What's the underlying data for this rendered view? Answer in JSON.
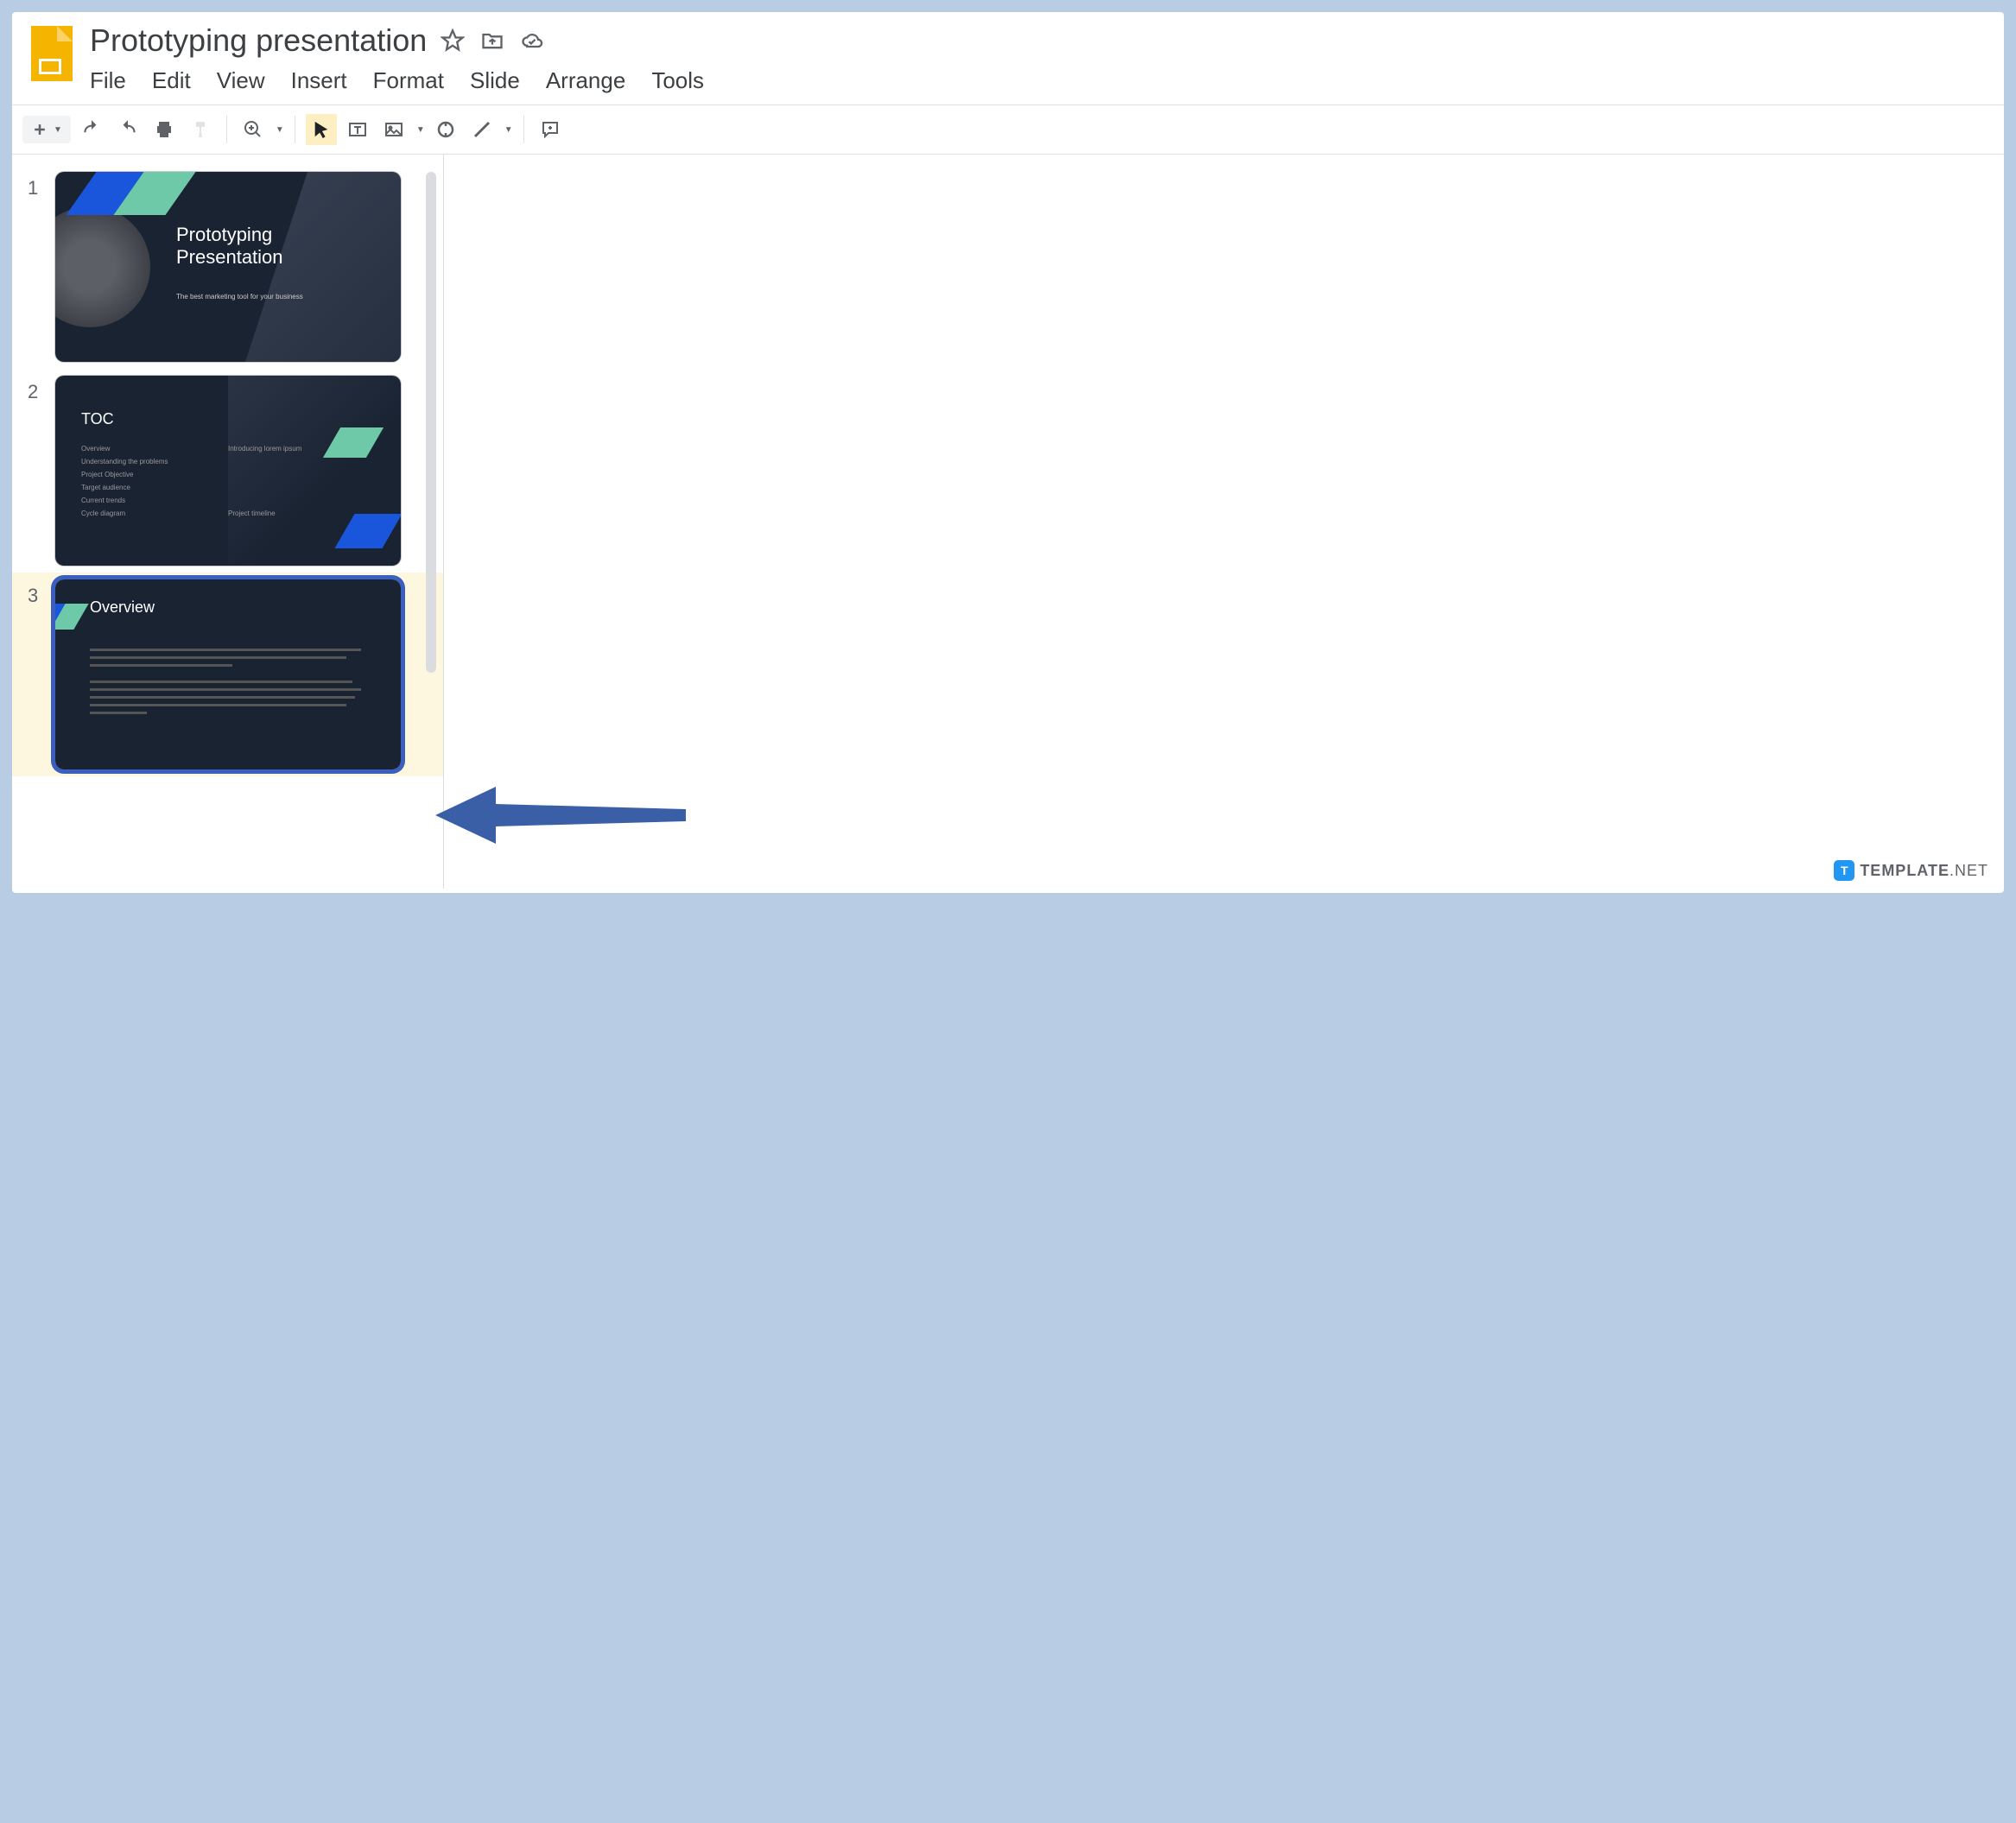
{
  "header": {
    "title": "Prototyping presentation"
  },
  "menu": {
    "file": "File",
    "edit": "Edit",
    "view": "View",
    "insert": "Insert",
    "format": "Format",
    "slide": "Slide",
    "arrange": "Arrange",
    "tools": "Tools"
  },
  "slides": [
    {
      "number": "1",
      "title": "Prototyping\nPresentation",
      "subtitle": "The best marketing tool for your business",
      "selected": false
    },
    {
      "number": "2",
      "title": "TOC",
      "items_left": [
        "Overview",
        "Understanding the problems",
        "Project Objective",
        "Target audience",
        "Current trends",
        "Cycle diagram"
      ],
      "items_right_head": "Introducing lorem ipsum",
      "items_right_foot": "Project timeline",
      "selected": false
    },
    {
      "number": "3",
      "title": "Overview",
      "selected": true
    }
  ],
  "watermark": {
    "icon": "T",
    "text1": "TEMPLATE",
    "text2": ".NET"
  }
}
